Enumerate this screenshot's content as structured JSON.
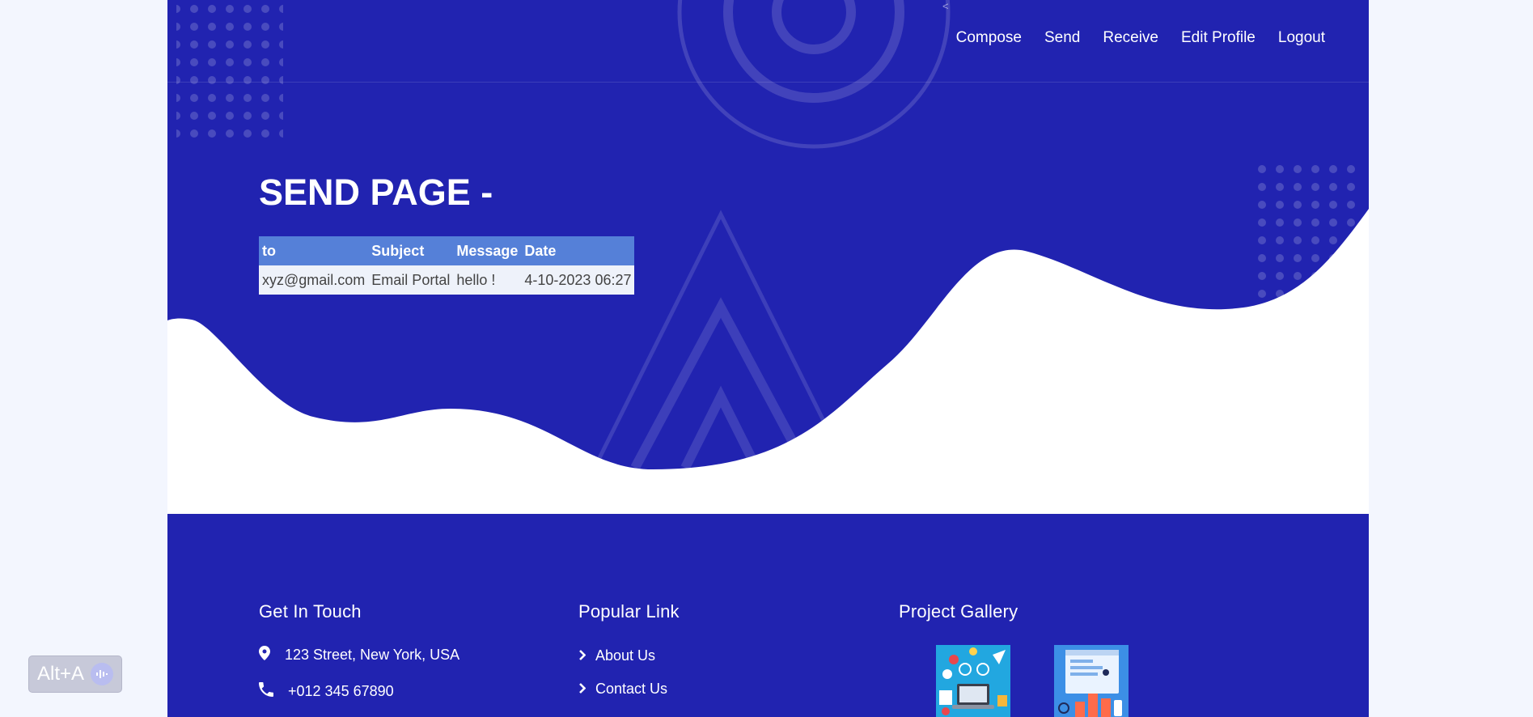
{
  "nav": {
    "items": [
      "Compose",
      "Send",
      "Receive",
      "Edit Profile",
      "Logout"
    ]
  },
  "page_title": "SEND PAGE -",
  "table": {
    "headers": [
      "to",
      "Subject",
      "Message",
      "Date"
    ],
    "rows": [
      [
        "xyz@gmail.com",
        "Email Portal",
        "hello !",
        "4-10-2023 06:27"
      ]
    ]
  },
  "footer": {
    "contact": {
      "heading": "Get In Touch",
      "address": "123 Street, New York, USA",
      "phone": "+012 345 67890"
    },
    "links": {
      "heading": "Popular Link",
      "items": [
        "About Us",
        "Contact Us"
      ]
    },
    "gallery": {
      "heading": "Project Gallery"
    }
  },
  "shortcut_badge": "Alt+A",
  "colors": {
    "primary": "#2123b0",
    "table_header": "#5580d8",
    "page_background": "#f3f6fe"
  },
  "icons": [
    "map-pin-icon",
    "phone-icon",
    "chevron-right-icon",
    "audio-wave-icon"
  ]
}
